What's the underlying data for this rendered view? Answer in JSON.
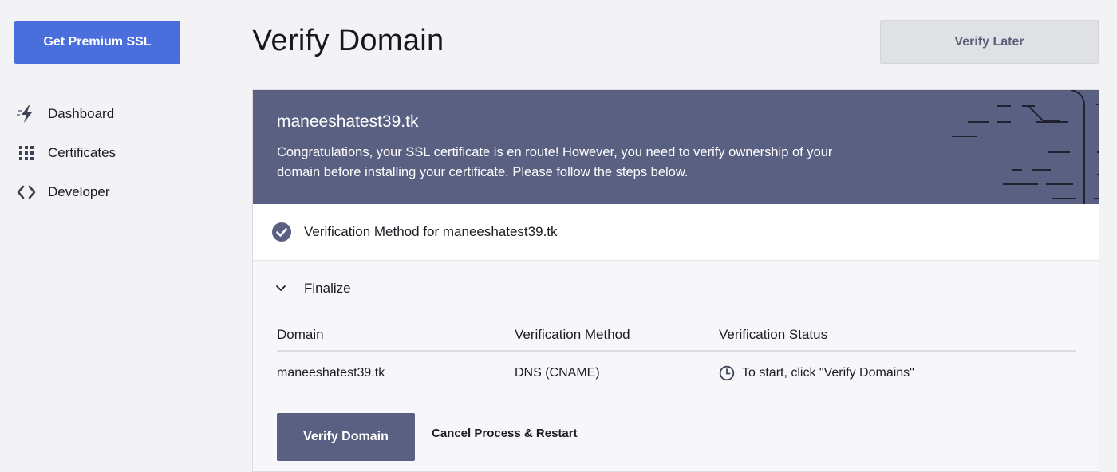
{
  "sidebar": {
    "premium_button": "Get Premium SSL",
    "items": [
      {
        "label": "Dashboard",
        "icon": "lightning-icon"
      },
      {
        "label": "Certificates",
        "icon": "grid-icon"
      },
      {
        "label": "Developer",
        "icon": "code-icon"
      }
    ]
  },
  "header": {
    "title": "Verify Domain",
    "verify_later": "Verify Later"
  },
  "banner": {
    "domain": "maneeshatest39.tk",
    "message": "Congratulations, your SSL certificate is en route! However, you need to verify ownership of your domain before installing your certificate. Please follow the steps below."
  },
  "steps": {
    "method": "Verification Method for maneeshatest39.tk",
    "finalize": "Finalize"
  },
  "table": {
    "headers": [
      "Domain",
      "Verification Method",
      "Verification Status"
    ],
    "rows": [
      {
        "domain": "maneeshatest39.tk",
        "method": "DNS (CNAME)",
        "status": "To start, click \"Verify Domains\""
      }
    ]
  },
  "actions": {
    "verify": "Verify Domain",
    "cancel": "Cancel Process & Restart"
  },
  "colors": {
    "primary": "#4a6fdc",
    "banner": "#596081"
  }
}
